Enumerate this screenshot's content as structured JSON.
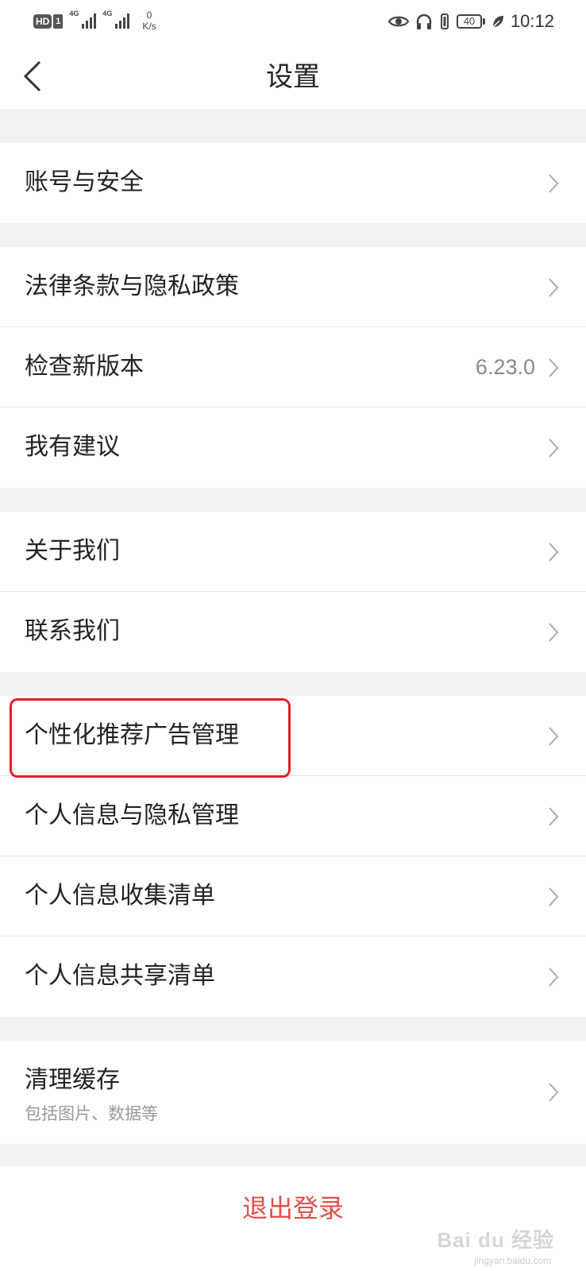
{
  "status_bar": {
    "hd_label": "HD",
    "sim_label": "1",
    "network_1": "4G",
    "network_2": "4G",
    "speed_value": "0",
    "speed_unit": "K/s",
    "battery_level": "40",
    "time": "10:12"
  },
  "header": {
    "title": "设置"
  },
  "groups": [
    {
      "items": [
        {
          "label": "账号与安全"
        }
      ]
    },
    {
      "items": [
        {
          "label": "法律条款与隐私政策"
        },
        {
          "label": "检查新版本",
          "value": "6.23.0"
        },
        {
          "label": "我有建议"
        }
      ]
    },
    {
      "items": [
        {
          "label": "关于我们"
        },
        {
          "label": "联系我们"
        }
      ]
    },
    {
      "items": [
        {
          "label": "个性化推荐广告管理"
        },
        {
          "label": "个人信息与隐私管理"
        },
        {
          "label": "个人信息收集清单"
        },
        {
          "label": "个人信息共享清单"
        }
      ]
    },
    {
      "items": [
        {
          "label": "清理缓存",
          "sublabel": "包括图片、数据等"
        }
      ]
    }
  ],
  "footer": {
    "logout_label": "退出登录",
    "watermark": "Bai du 经验",
    "watermark_url": "jingyan.baidu.com"
  },
  "colors": {
    "accent_red": "#e0504a",
    "highlight": "#e0202a",
    "background": "#f2f2f2"
  }
}
